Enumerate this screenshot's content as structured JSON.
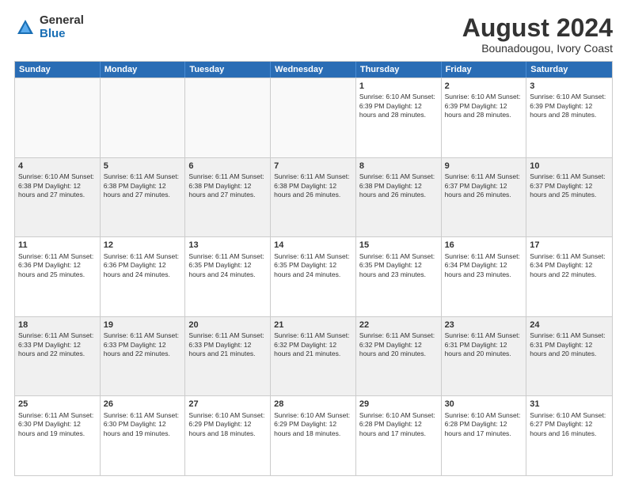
{
  "header": {
    "logo": {
      "general": "General",
      "blue": "Blue"
    },
    "title": "August 2024",
    "subtitle": "Bounadougou, Ivory Coast"
  },
  "calendar": {
    "days": [
      "Sunday",
      "Monday",
      "Tuesday",
      "Wednesday",
      "Thursday",
      "Friday",
      "Saturday"
    ],
    "weeks": [
      [
        {
          "day": "",
          "empty": true
        },
        {
          "day": "",
          "empty": true
        },
        {
          "day": "",
          "empty": true
        },
        {
          "day": "",
          "empty": true
        },
        {
          "day": "1",
          "text": "Sunrise: 6:10 AM\nSunset: 6:39 PM\nDaylight: 12 hours\nand 28 minutes."
        },
        {
          "day": "2",
          "text": "Sunrise: 6:10 AM\nSunset: 6:39 PM\nDaylight: 12 hours\nand 28 minutes."
        },
        {
          "day": "3",
          "text": "Sunrise: 6:10 AM\nSunset: 6:39 PM\nDaylight: 12 hours\nand 28 minutes."
        }
      ],
      [
        {
          "day": "4",
          "text": "Sunrise: 6:10 AM\nSunset: 6:38 PM\nDaylight: 12 hours\nand 27 minutes."
        },
        {
          "day": "5",
          "text": "Sunrise: 6:11 AM\nSunset: 6:38 PM\nDaylight: 12 hours\nand 27 minutes."
        },
        {
          "day": "6",
          "text": "Sunrise: 6:11 AM\nSunset: 6:38 PM\nDaylight: 12 hours\nand 27 minutes."
        },
        {
          "day": "7",
          "text": "Sunrise: 6:11 AM\nSunset: 6:38 PM\nDaylight: 12 hours\nand 26 minutes."
        },
        {
          "day": "8",
          "text": "Sunrise: 6:11 AM\nSunset: 6:38 PM\nDaylight: 12 hours\nand 26 minutes."
        },
        {
          "day": "9",
          "text": "Sunrise: 6:11 AM\nSunset: 6:37 PM\nDaylight: 12 hours\nand 26 minutes."
        },
        {
          "day": "10",
          "text": "Sunrise: 6:11 AM\nSunset: 6:37 PM\nDaylight: 12 hours\nand 25 minutes."
        }
      ],
      [
        {
          "day": "11",
          "text": "Sunrise: 6:11 AM\nSunset: 6:36 PM\nDaylight: 12 hours\nand 25 minutes."
        },
        {
          "day": "12",
          "text": "Sunrise: 6:11 AM\nSunset: 6:36 PM\nDaylight: 12 hours\nand 24 minutes."
        },
        {
          "day": "13",
          "text": "Sunrise: 6:11 AM\nSunset: 6:35 PM\nDaylight: 12 hours\nand 24 minutes."
        },
        {
          "day": "14",
          "text": "Sunrise: 6:11 AM\nSunset: 6:35 PM\nDaylight: 12 hours\nand 24 minutes."
        },
        {
          "day": "15",
          "text": "Sunrise: 6:11 AM\nSunset: 6:35 PM\nDaylight: 12 hours\nand 23 minutes."
        },
        {
          "day": "16",
          "text": "Sunrise: 6:11 AM\nSunset: 6:34 PM\nDaylight: 12 hours\nand 23 minutes."
        },
        {
          "day": "17",
          "text": "Sunrise: 6:11 AM\nSunset: 6:34 PM\nDaylight: 12 hours\nand 22 minutes."
        }
      ],
      [
        {
          "day": "18",
          "text": "Sunrise: 6:11 AM\nSunset: 6:33 PM\nDaylight: 12 hours\nand 22 minutes."
        },
        {
          "day": "19",
          "text": "Sunrise: 6:11 AM\nSunset: 6:33 PM\nDaylight: 12 hours\nand 22 minutes."
        },
        {
          "day": "20",
          "text": "Sunrise: 6:11 AM\nSunset: 6:33 PM\nDaylight: 12 hours\nand 21 minutes."
        },
        {
          "day": "21",
          "text": "Sunrise: 6:11 AM\nSunset: 6:32 PM\nDaylight: 12 hours\nand 21 minutes."
        },
        {
          "day": "22",
          "text": "Sunrise: 6:11 AM\nSunset: 6:32 PM\nDaylight: 12 hours\nand 20 minutes."
        },
        {
          "day": "23",
          "text": "Sunrise: 6:11 AM\nSunset: 6:31 PM\nDaylight: 12 hours\nand 20 minutes."
        },
        {
          "day": "24",
          "text": "Sunrise: 6:11 AM\nSunset: 6:31 PM\nDaylight: 12 hours\nand 20 minutes."
        }
      ],
      [
        {
          "day": "25",
          "text": "Sunrise: 6:11 AM\nSunset: 6:30 PM\nDaylight: 12 hours\nand 19 minutes."
        },
        {
          "day": "26",
          "text": "Sunrise: 6:11 AM\nSunset: 6:30 PM\nDaylight: 12 hours\nand 19 minutes."
        },
        {
          "day": "27",
          "text": "Sunrise: 6:10 AM\nSunset: 6:29 PM\nDaylight: 12 hours\nand 18 minutes."
        },
        {
          "day": "28",
          "text": "Sunrise: 6:10 AM\nSunset: 6:29 PM\nDaylight: 12 hours\nand 18 minutes."
        },
        {
          "day": "29",
          "text": "Sunrise: 6:10 AM\nSunset: 6:28 PM\nDaylight: 12 hours\nand 17 minutes."
        },
        {
          "day": "30",
          "text": "Sunrise: 6:10 AM\nSunset: 6:28 PM\nDaylight: 12 hours\nand 17 minutes."
        },
        {
          "day": "31",
          "text": "Sunrise: 6:10 AM\nSunset: 6:27 PM\nDaylight: 12 hours\nand 16 minutes."
        }
      ]
    ]
  }
}
